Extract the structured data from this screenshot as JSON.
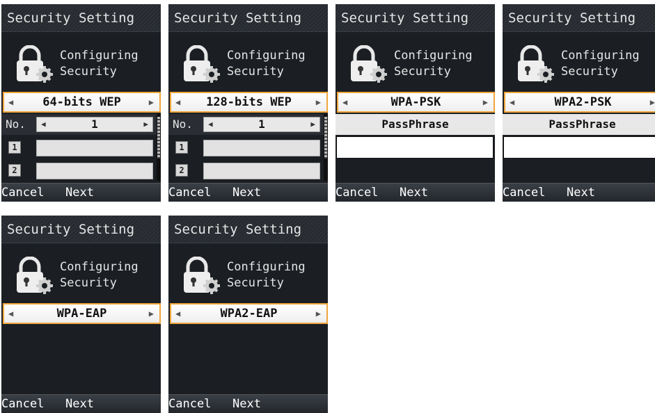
{
  "title": "Security Setting",
  "config_line1": "Configuring",
  "config_line2": "Security",
  "softkeys": {
    "cancel": "Cancel",
    "next": "Next"
  },
  "screens": [
    {
      "mode": "64-bits WEP",
      "no_label": "No.",
      "no_value": "1",
      "keys": [
        "1",
        "2"
      ]
    },
    {
      "mode": "128-bits WEP",
      "no_label": "No.",
      "no_value": "1",
      "keys": [
        "1",
        "2"
      ]
    },
    {
      "mode": "WPA-PSK",
      "passphrase_label": "PassPhrase",
      "passphrase_value": ""
    },
    {
      "mode": "WPA2-PSK",
      "passphrase_label": "PassPhrase",
      "passphrase_value": ""
    },
    {
      "mode": "WPA-EAP"
    },
    {
      "mode": "WPA2-EAP"
    }
  ],
  "icons": [
    "lock-gear-icon",
    "arrow-left-icon",
    "arrow-right-icon"
  ],
  "colors": {
    "background": "#1b1f24",
    "selector_border": "#f0a63c",
    "text": "#e6e6e6"
  }
}
